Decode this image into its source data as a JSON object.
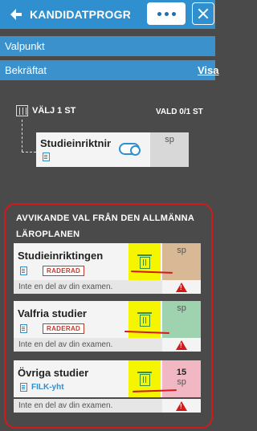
{
  "header": {
    "title": "KANDIDATPROGRAMMET",
    "more_icon": "ellipsis-icon",
    "close_icon": "close-icon",
    "brand_color": "#2f8fcf"
  },
  "nav": {
    "checkpoint_label": "Valpunkt",
    "confirmed_label": "Bekräftat",
    "link_label": "Visa"
  },
  "selection": {
    "choose_label": "VÄLJ 1 ST",
    "selected_label": "VALD 0/1 ST"
  },
  "main_course": {
    "name": "Studieinriktning",
    "sp": "sp"
  },
  "deviating": {
    "title": "AVVIKANDE VAL FRÅN DEN ALLMÄNNA LÄROPLANEN",
    "items": [
      {
        "name": "Studieinriktingen",
        "badge": "RADERAD",
        "note": "Inte en del av din examen.",
        "sp_value": "",
        "sp_unit": "sp",
        "color": "#d9b896"
      },
      {
        "name": "Valfria studier",
        "badge": "RADERAD",
        "note": "Inte en del av din examen.",
        "sp_value": "",
        "sp_unit": "sp",
        "color": "#9fd3b0"
      },
      {
        "name": "Övriga studier",
        "badge": "FILK-yht",
        "note": "Inte en del av din examen.",
        "sp_value": "15",
        "sp_unit": "sp",
        "color": "#f1b7c2"
      }
    ]
  },
  "warning_symbol": "!"
}
